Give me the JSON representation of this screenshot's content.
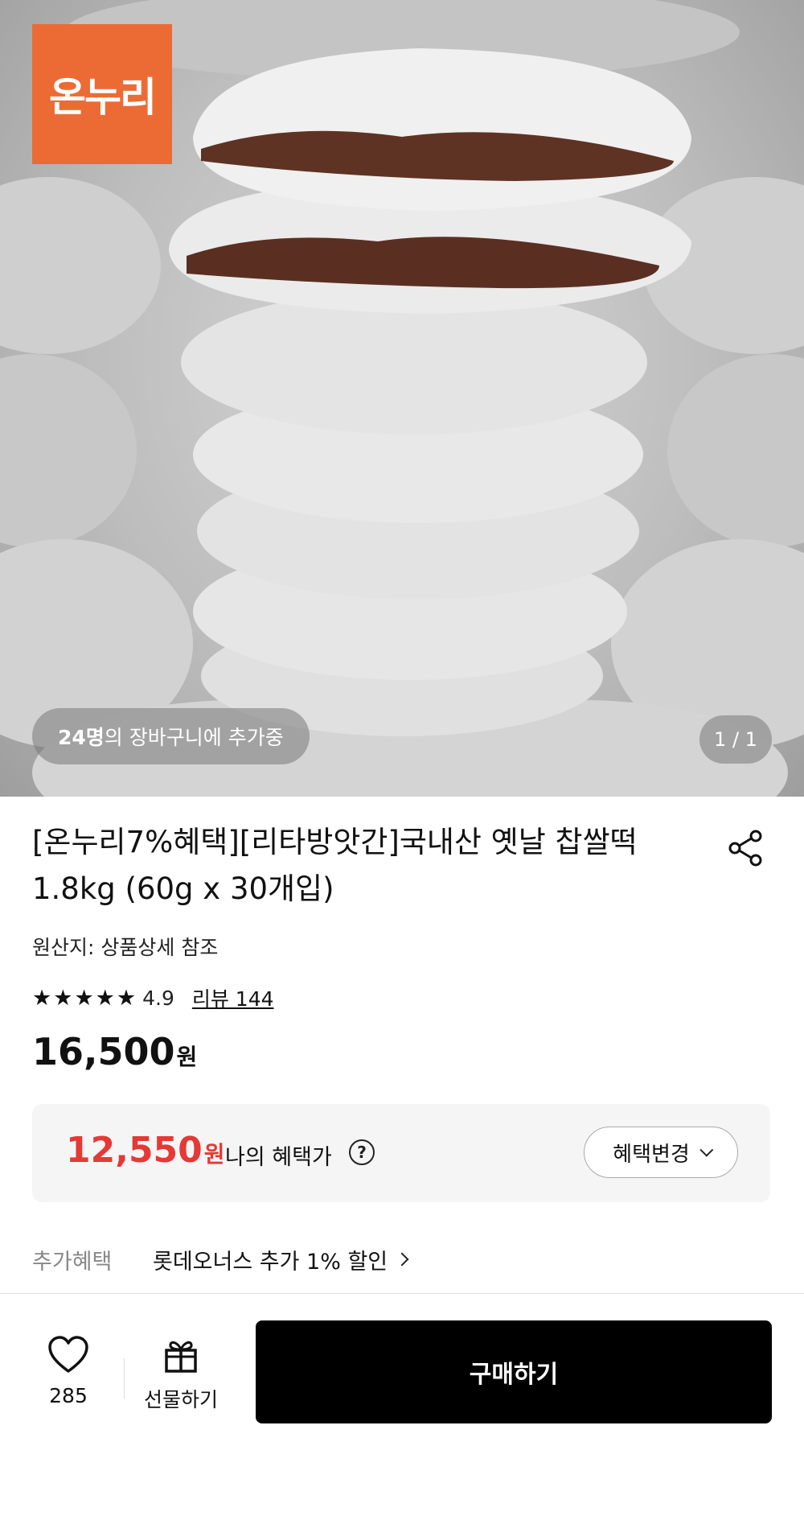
{
  "hero": {
    "brand_logo_text": "온누리",
    "cart_count": "24명",
    "cart_suffix": "의 장바구니에 추가중",
    "page_indicator": "1 / 1"
  },
  "product": {
    "title": "[온누리7%혜택][리타방앗간]국내산 옛날 찹쌀떡 1.8kg (60g x 30개입)",
    "origin": "원산지: 상품상세 참조",
    "rating": "4.9",
    "stars": 5,
    "review_link": "리뷰 144",
    "price": "16,500",
    "price_unit": "원"
  },
  "benefit": {
    "price": "12,550",
    "price_unit": "원",
    "label": "나의 혜택가",
    "help_icon": "?",
    "change_button": "혜택변경"
  },
  "extra_benefit": {
    "label": "추가혜택",
    "value": "롯데오너스 추가 1% 할인"
  },
  "bottom_bar": {
    "like_count": "285",
    "gift_label": "선물하기",
    "buy_label": "구매하기"
  },
  "colors": {
    "brand_orange": "#ec6b35",
    "benefit_red": "#e53935",
    "buy_button": "#000000"
  }
}
